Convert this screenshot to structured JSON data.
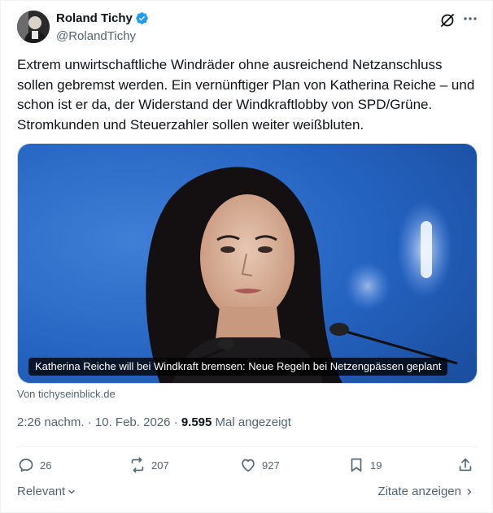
{
  "author": {
    "display_name": "Roland Tichy",
    "handle": "@RolandTichy"
  },
  "tweet": {
    "text": "Extrem unwirtschaftliche Windräder ohne ausreichend Netzanschluss sollen gebremst werden. Ein vernünftiger Plan von Katherina Reiche – und schon ist er da, der Widerstand der Windkraftlobby von SPD/Grüne. Stromkunden und Steuerzahler sollen weiter weißbluten."
  },
  "media": {
    "caption": "Katherina Reiche will bei Windkraft bremsen: Neue Regeln bei Netzengpässen geplant",
    "source": "Von tichyseinblick.de"
  },
  "meta": {
    "time": "2:26 nachm.",
    "date": "10. Feb. 2026",
    "separator": "·",
    "views_count": "9.595",
    "views_label": "Mal angezeigt"
  },
  "actions": {
    "replies": "26",
    "reposts": "207",
    "likes": "927",
    "bookmarks": "19"
  },
  "footer": {
    "sort_label": "Relevant",
    "quotes_label": "Zitate anzeigen"
  },
  "colors": {
    "verified": "#1d9bf0",
    "secondary_text": "#536471",
    "primary_text": "#0f1419"
  }
}
